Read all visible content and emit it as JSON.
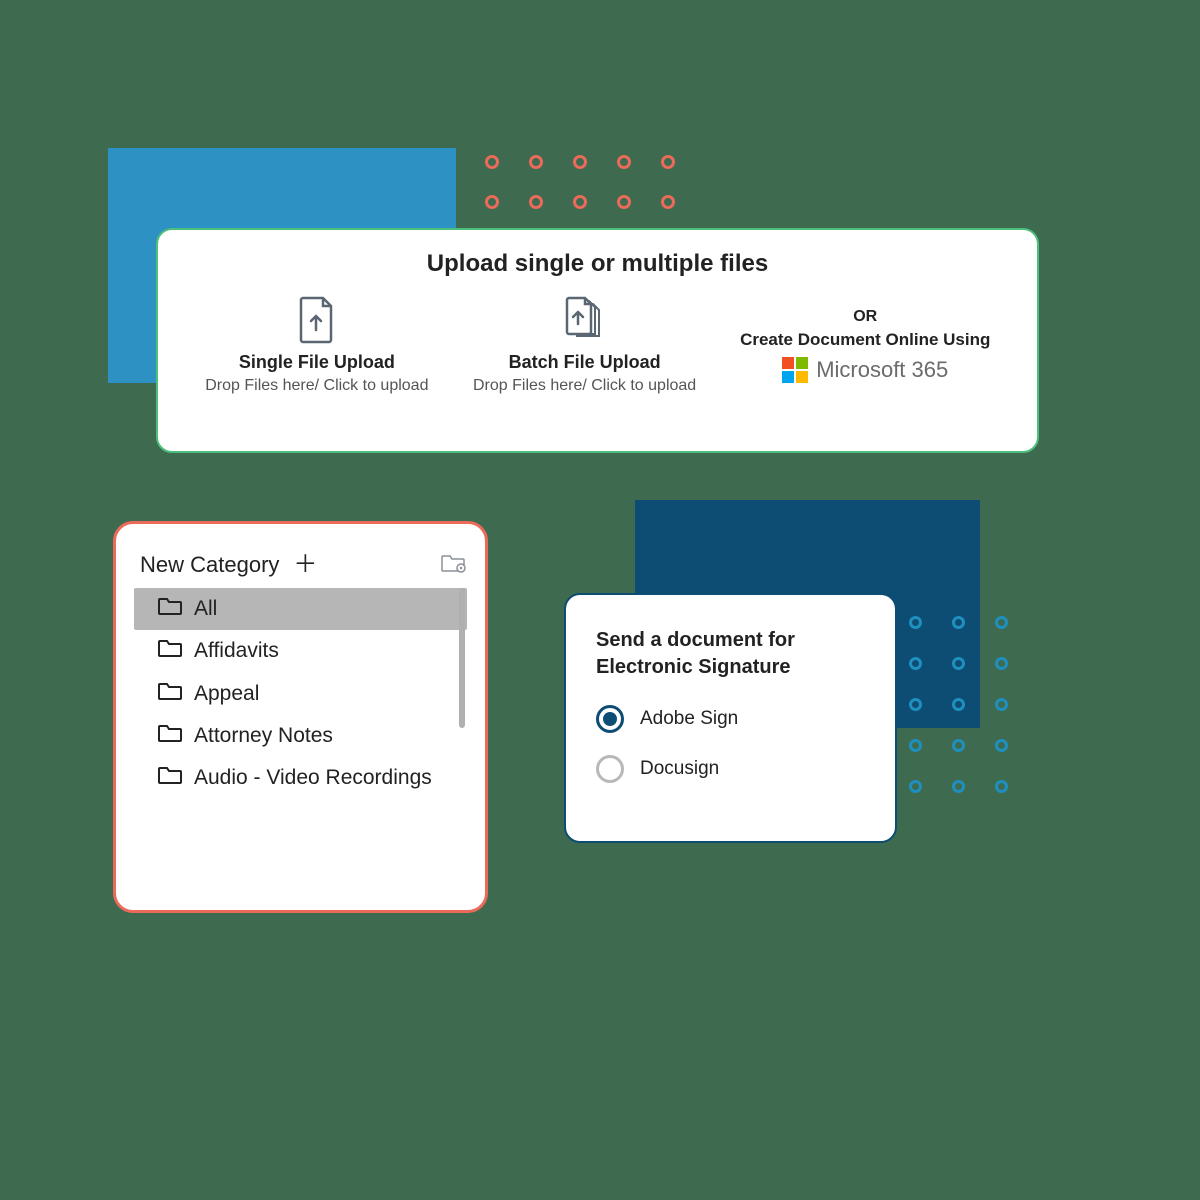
{
  "upload": {
    "title": "Upload single or multiple files",
    "single": {
      "label": "Single File Upload",
      "hint": "Drop Files here/ Click to upload"
    },
    "batch": {
      "label": "Batch File Upload",
      "hint": "Drop Files here/ Click to upload"
    },
    "create": {
      "or": "OR",
      "label": "Create Document Online Using",
      "ms365": "Microsoft 365"
    }
  },
  "categories": {
    "header": "New Category",
    "items": [
      {
        "label": "All",
        "selected": true
      },
      {
        "label": "Affidavits",
        "selected": false
      },
      {
        "label": "Appeal",
        "selected": false
      },
      {
        "label": "Attorney Notes",
        "selected": false
      },
      {
        "label": "Audio - Video Recordings",
        "selected": false
      }
    ]
  },
  "signature": {
    "title": "Send a document for Electronic Signature",
    "options": [
      {
        "label": "Adobe Sign",
        "selected": true
      },
      {
        "label": "Docusign",
        "selected": false
      }
    ]
  }
}
